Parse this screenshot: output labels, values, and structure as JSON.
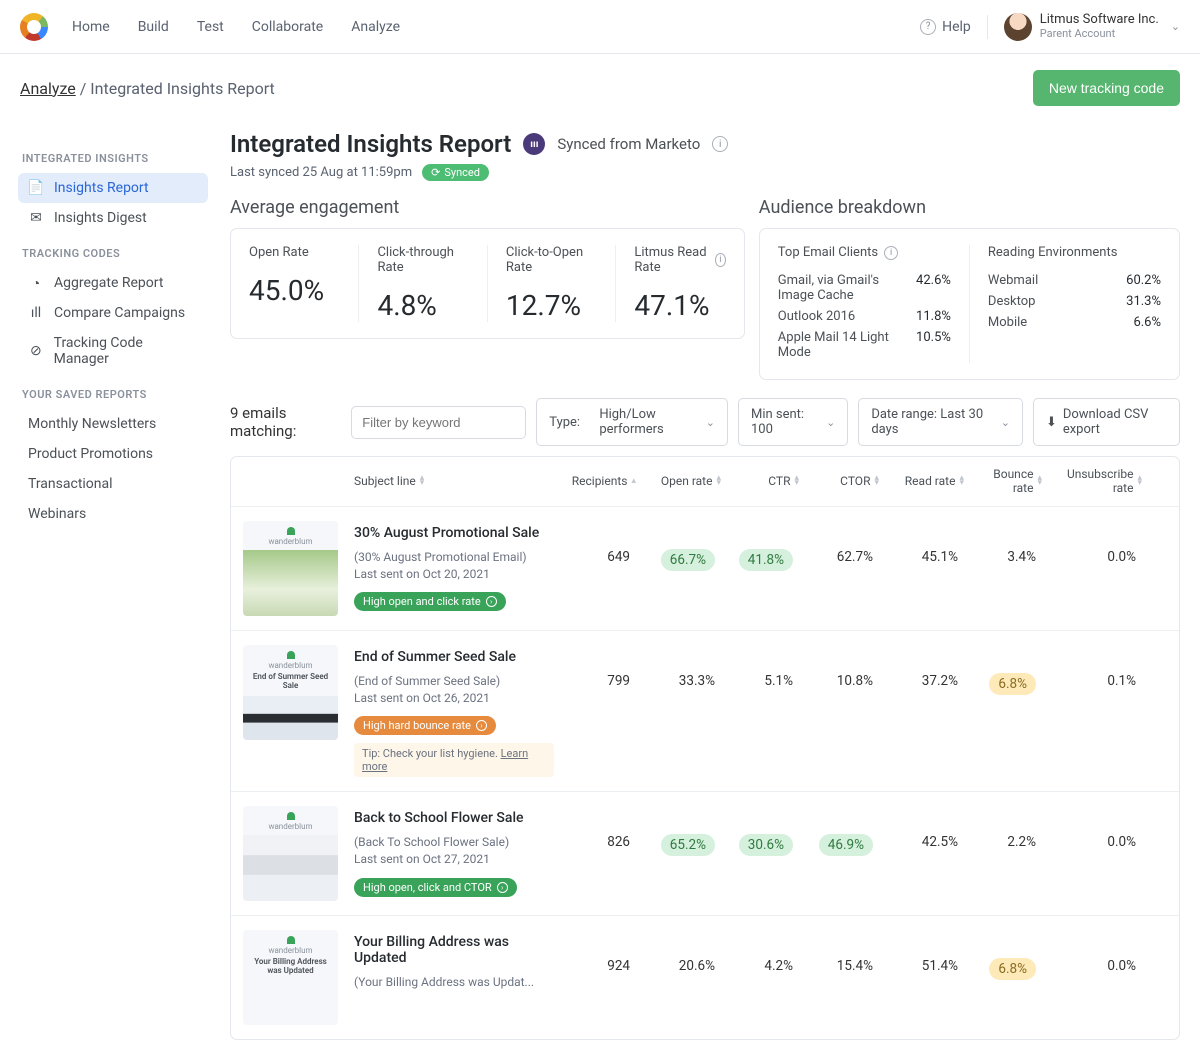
{
  "nav": {
    "links": [
      "Home",
      "Build",
      "Test",
      "Collaborate",
      "Analyze"
    ],
    "help": "Help"
  },
  "account": {
    "name": "Litmus Software Inc.",
    "sub": "Parent Account"
  },
  "breadcrumb": {
    "root": "Analyze",
    "sep": " / ",
    "page": "Integrated Insights Report"
  },
  "cta": "New tracking code",
  "sidebar": {
    "g1": {
      "head": "INTEGRATED INSIGHTS",
      "items": [
        "Insights Report",
        "Insights Digest"
      ]
    },
    "g2": {
      "head": "TRACKING CODES",
      "items": [
        "Aggregate Report",
        "Compare Campaigns",
        "Tracking Code Manager"
      ]
    },
    "g3": {
      "head": "YOUR SAVED REPORTS",
      "items": [
        "Monthly Newsletters",
        "Product Promotions",
        "Transactional",
        "Webinars"
      ]
    }
  },
  "page": {
    "title": "Integrated Insights Report",
    "synced_from": "Synced from Marketo",
    "last_synced": "Last synced 25 Aug at 11:59pm",
    "sync_badge": "Synced"
  },
  "engagement": {
    "title": "Average engagement",
    "metrics": [
      {
        "label": "Open Rate",
        "val": "45.0%"
      },
      {
        "label": "Click-through Rate",
        "val": "4.8%"
      },
      {
        "label": "Click-to-Open Rate",
        "val": "12.7%"
      },
      {
        "label": "Litmus Read Rate",
        "val": "47.1%"
      }
    ]
  },
  "audience": {
    "title": "Audience breakdown",
    "col1": {
      "head": "Top Email Clients",
      "rows": [
        {
          "k": "Gmail, via Gmail's Image Cache",
          "v": "42.6%"
        },
        {
          "k": "Outlook 2016",
          "v": "11.8%"
        },
        {
          "k": "Apple Mail 14 Light Mode",
          "v": "10.5%"
        }
      ]
    },
    "col2": {
      "head": "Reading Environments",
      "rows": [
        {
          "k": "Webmail",
          "v": "60.2%"
        },
        {
          "k": "Desktop",
          "v": "31.3%"
        },
        {
          "k": "Mobile",
          "v": "6.6%"
        }
      ]
    }
  },
  "filters": {
    "count": "9 emails matching:",
    "placeholder": "Filter by keyword",
    "type_label": "Type:",
    "type_val": "High/Low performers",
    "min_sent": "Min sent: 100",
    "date_range": "Date range: Last 30 days",
    "download": "Download CSV export"
  },
  "columns": {
    "subject": "Subject line",
    "recipients": "Recipients",
    "open": "Open rate",
    "ctr": "CTR",
    "ctor": "CTOR",
    "read": "Read rate",
    "bounce1": "Bounce",
    "bounce2": "rate",
    "unsub1": "Unsubscribe",
    "unsub2": "rate"
  },
  "rows": [
    {
      "thumb": "garden",
      "thumb_text": "",
      "title": "30% August Promotional Sale",
      "meta": "(30% August Promotional Email)",
      "sent": "Last sent on Oct 20, 2021",
      "badge": {
        "kind": "green",
        "text": "High open and click rate"
      },
      "tip": "",
      "tip_link": "",
      "recipients": "649",
      "open": "66.7%",
      "open_hl": true,
      "ctr": "41.8%",
      "ctr_hl": true,
      "ctor": "62.7%",
      "ctor_hl": false,
      "read": "45.1%",
      "bounce": "3.4%",
      "bounce_hl": false,
      "unsub": "0.0%"
    },
    {
      "thumb": "person",
      "thumb_text": "End of Summer Seed Sale",
      "title": "End of Summer Seed Sale",
      "meta": "(End of Summer Seed Sale)",
      "sent": "Last sent on Oct 26, 2021",
      "badge": {
        "kind": "orange",
        "text": "High hard bounce rate"
      },
      "tip": "Tip: Check your list hygiene. ",
      "tip_link": "Learn more",
      "recipients": "799",
      "open": "33.3%",
      "open_hl": false,
      "ctr": "5.1%",
      "ctr_hl": false,
      "ctor": "10.8%",
      "ctor_hl": false,
      "read": "37.2%",
      "bounce": "6.8%",
      "bounce_hl": true,
      "unsub": "0.1%"
    },
    {
      "thumb": "books",
      "thumb_text": "",
      "title": "Back to School Flower Sale",
      "meta": "(Back To School Flower Sale)",
      "sent": "Last sent on Oct 27, 2021",
      "badge": {
        "kind": "green",
        "text": "High open, click and CTOR"
      },
      "tip": "",
      "tip_link": "",
      "recipients": "826",
      "open": "65.2%",
      "open_hl": true,
      "ctr": "30.6%",
      "ctr_hl": true,
      "ctor": "46.9%",
      "ctor_hl": true,
      "read": "42.5%",
      "bounce": "2.2%",
      "bounce_hl": false,
      "unsub": "0.0%"
    },
    {
      "thumb": "plain",
      "thumb_text": "Your Billing Address was Updated",
      "title": "Your Billing Address was Updated",
      "meta": "(Your Billing Address was Updat...",
      "sent": "",
      "badge": null,
      "tip": "",
      "tip_link": "",
      "recipients": "924",
      "open": "20.6%",
      "open_hl": false,
      "ctr": "4.2%",
      "ctr_hl": false,
      "ctor": "15.4%",
      "ctor_hl": false,
      "read": "51.4%",
      "bounce": "6.8%",
      "bounce_hl": true,
      "unsub": "0.0%"
    }
  ]
}
